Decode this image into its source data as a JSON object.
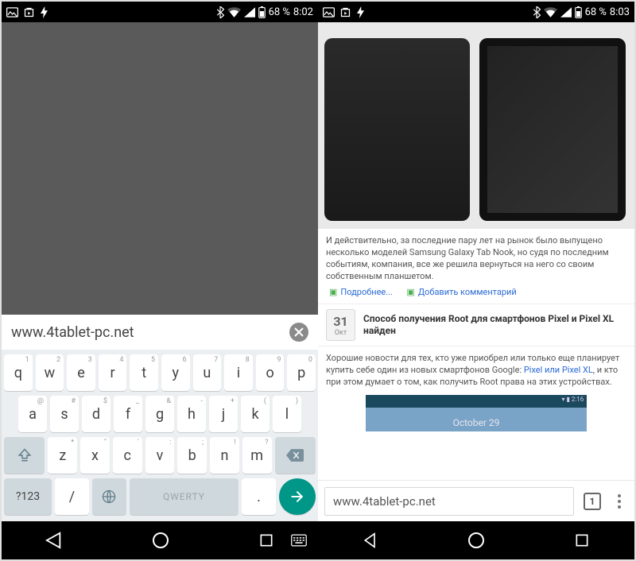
{
  "left": {
    "status": {
      "battery": "68 %",
      "time": "8:02"
    },
    "url": "www.4tablet-pc.net",
    "keyboard": {
      "row1": [
        {
          "k": "q",
          "s": "1"
        },
        {
          "k": "w",
          "s": "2"
        },
        {
          "k": "e",
          "s": "3"
        },
        {
          "k": "r",
          "s": "4"
        },
        {
          "k": "t",
          "s": "5"
        },
        {
          "k": "y",
          "s": "6"
        },
        {
          "k": "u",
          "s": "7"
        },
        {
          "k": "i",
          "s": "8"
        },
        {
          "k": "o",
          "s": "9"
        },
        {
          "k": "p",
          "s": "0"
        }
      ],
      "row2": [
        {
          "k": "a",
          "s": "@"
        },
        {
          "k": "s",
          "s": "#"
        },
        {
          "k": "d",
          "s": "$"
        },
        {
          "k": "f",
          "s": "_"
        },
        {
          "k": "g",
          "s": "&"
        },
        {
          "k": "h",
          "s": "-"
        },
        {
          "k": "j",
          "s": "+"
        },
        {
          "k": "k",
          "s": "("
        },
        {
          "k": "l",
          "s": ")"
        }
      ],
      "row3": [
        {
          "k": "z",
          "s": "*"
        },
        {
          "k": "x",
          "s": "\""
        },
        {
          "k": "c",
          "s": "'"
        },
        {
          "k": "v",
          "s": ":"
        },
        {
          "k": "b",
          "s": ";"
        },
        {
          "k": "n",
          "s": "!"
        },
        {
          "k": "m",
          "s": "?"
        }
      ],
      "sym": "?123",
      "slash": "/",
      "space": "QWERTY",
      "dot": "."
    }
  },
  "right": {
    "status": {
      "battery": "68 %",
      "time": "8:03"
    },
    "para1": "И действительно, за последние пару лет на рынок было выпущено несколько моделей Samsung Galaxy Tab Nook, но судя по последним событиям, компания, все же решила вернуться на него со своим собственным планшетом.",
    "link_more": "Подробнее...",
    "link_comment": "Добавить комментарий",
    "date": {
      "day": "31",
      "month": "Окт"
    },
    "headline": "Способ получения Root для смартфонов Pixel и Pixel XL найден",
    "para2_a": "Хорошие новости для тех, кто уже приобрел или только еще планирует купить себе один из новых смартфонов Google: ",
    "para2_link": "Pixel или Pixel XL",
    "para2_b": ", и кто при этом думает о том, как получить Root права на этих устройствах.",
    "mini_time": "▾ ▮ 2:16",
    "mini_date": "October 29",
    "omnibar": {
      "url": "www.4tablet-pc.net",
      "tabs": "1"
    }
  }
}
